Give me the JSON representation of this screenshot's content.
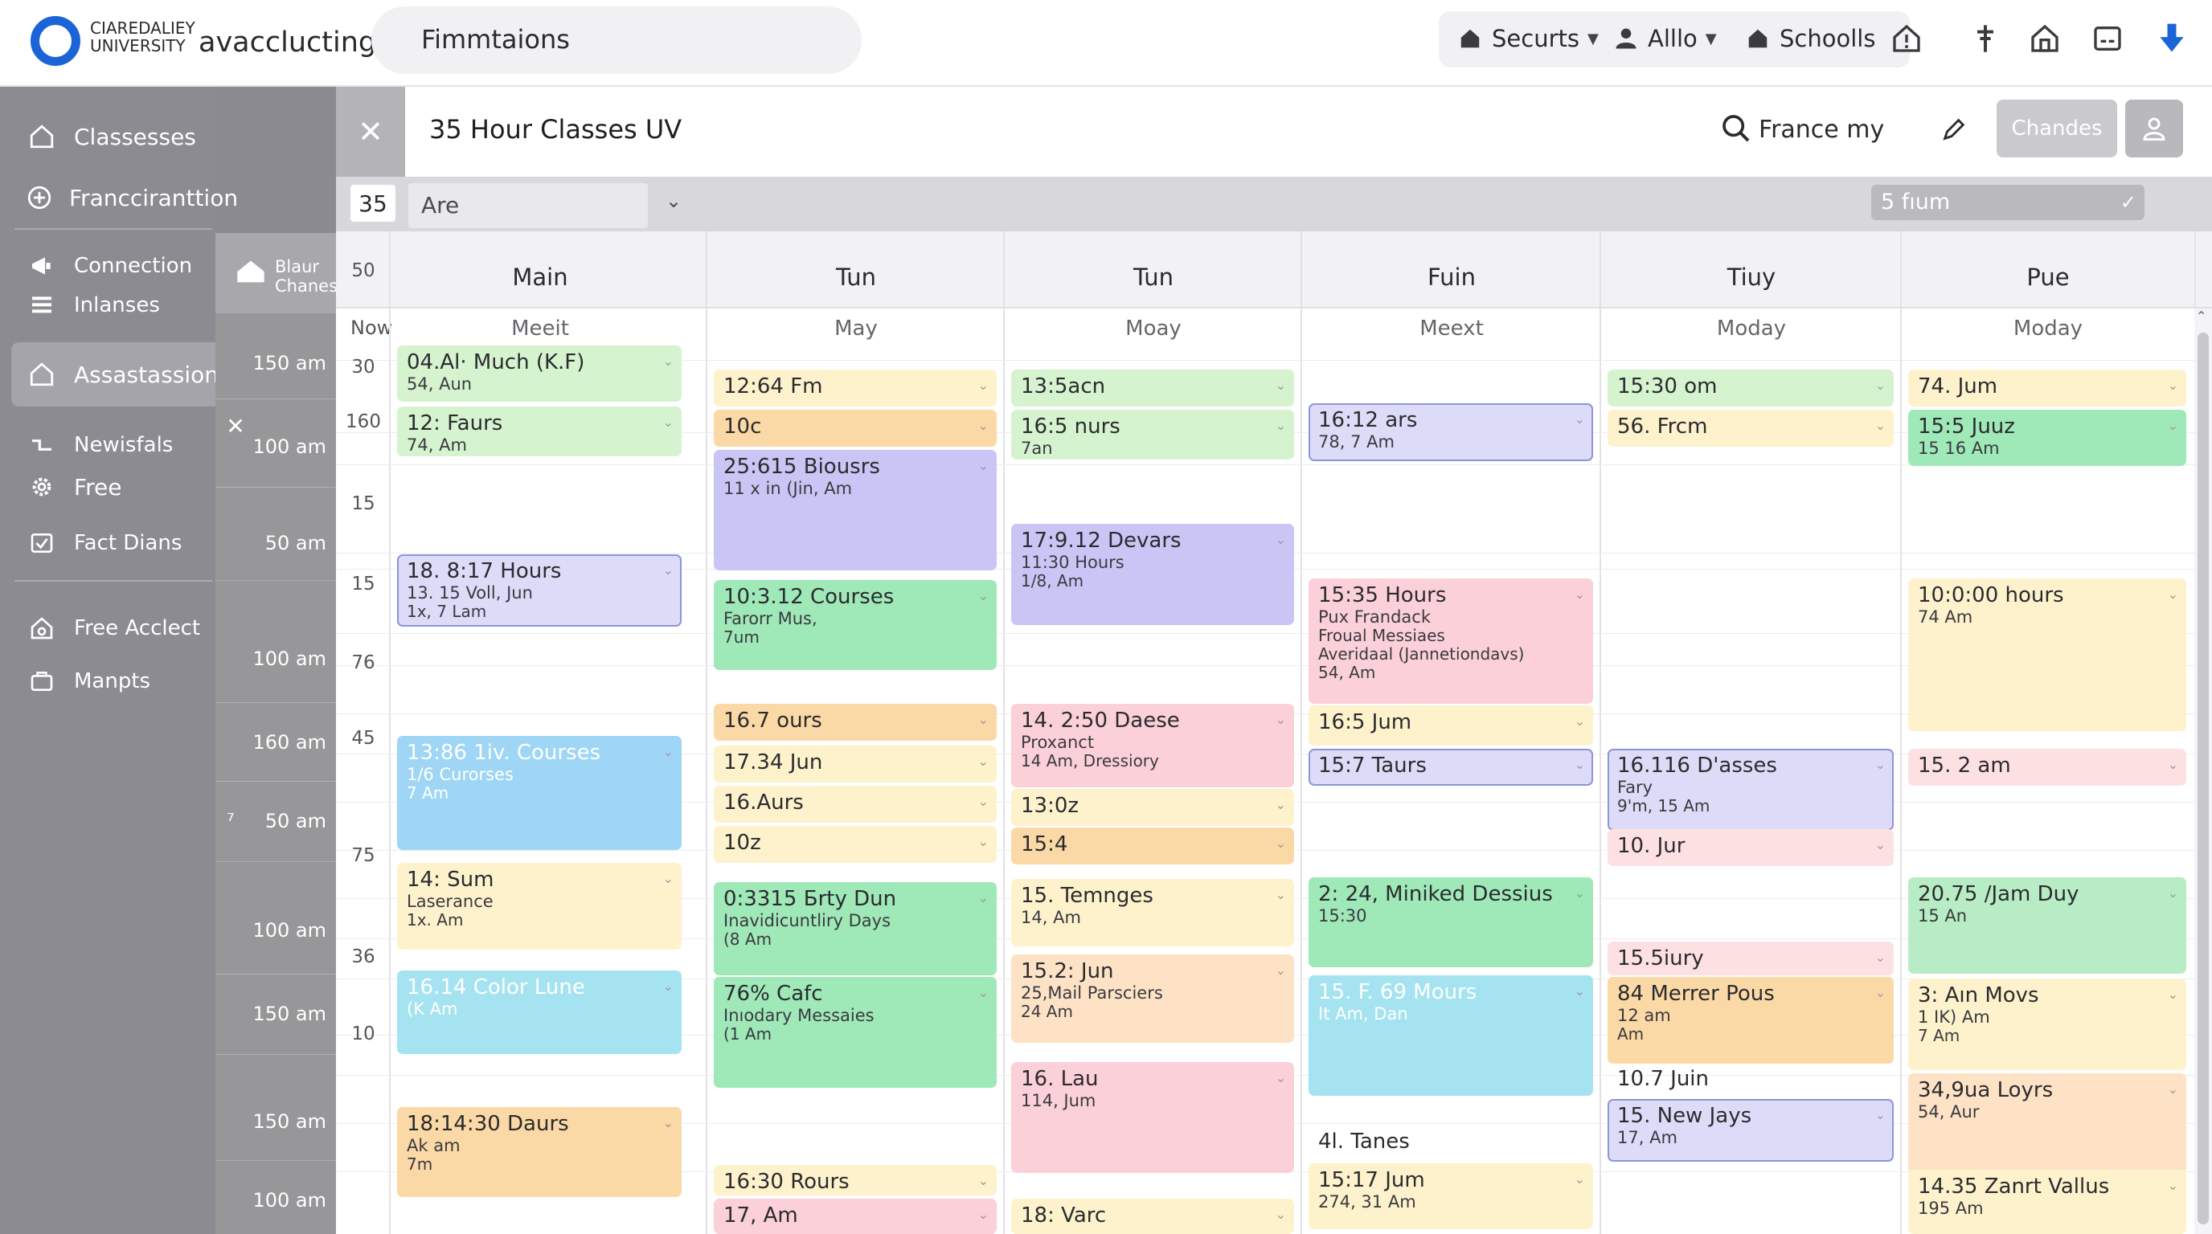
{
  "app": {
    "logo_small": "CIAREDALIEY UNIVERSITY",
    "logo_main": "avacclucting",
    "search_text": "Fimmtaions"
  },
  "topnav": {
    "items": [
      {
        "label": "Securts",
        "icon": "home-icon"
      },
      {
        "label": "Alllo",
        "icon": "user-icon"
      },
      {
        "label": "Schoolls",
        "icon": "home-icon"
      }
    ],
    "icons": [
      "alert-house-icon",
      "f-icon",
      "building-icon",
      "panel-icon",
      "download-icon"
    ]
  },
  "sidebar": {
    "items": [
      {
        "label": "Classesses",
        "icon": "home-icon"
      },
      {
        "label": "Francciranttion",
        "icon": "plus-circle-icon"
      },
      {
        "label": "Connection",
        "icon": "megaphone-icon"
      },
      {
        "label": "Inlanses",
        "icon": "list-icon"
      },
      {
        "label": "Assastassions",
        "icon": "home-icon",
        "active": true
      },
      {
        "label": "Newisfals",
        "icon": "route-icon"
      },
      {
        "label": "Free",
        "icon": "gear-icon"
      },
      {
        "label": "Fact Dians",
        "icon": "check-box-icon"
      },
      {
        "label": "Free Acclect",
        "icon": "home-gear-icon"
      },
      {
        "label": "Manpts",
        "icon": "briefcase-icon"
      }
    ],
    "sub_header": "Blaur Chanes",
    "times": [
      "150 am",
      "100 am",
      "50 am",
      "100 am",
      "160 am",
      "50 am",
      "100 am",
      "150 am",
      "150 am",
      "100 am"
    ]
  },
  "panel": {
    "title": "35 Hour Classes UV",
    "search_text": "France my",
    "changes_button": "Chandes",
    "filter_number": "35",
    "filter_select": "Are",
    "filter_right": "5 fıum"
  },
  "calendar": {
    "gutter_now": "Now",
    "row_numbers": [
      "10",
      "50",
      "30",
      "160",
      "15",
      "15",
      "76",
      "45",
      "75",
      "36",
      "10"
    ],
    "columns": [
      {
        "day": "Main",
        "sub": "Meeit"
      },
      {
        "day": "Tun",
        "sub": "May"
      },
      {
        "day": "Tun",
        "sub": "Moay"
      },
      {
        "day": "Fuin",
        "sub": "Meext"
      },
      {
        "day": "Tiuy",
        "sub": "Moday"
      },
      {
        "day": "Pue",
        "sub": "Moday"
      }
    ],
    "events": [
      {
        "col": 0,
        "lines": [
          "04.Al· Much (K.F)",
          "54, Aun"
        ],
        "color": "lgreen"
      },
      {
        "col": 0,
        "lines": [
          "12: Faurs",
          "74, Am"
        ],
        "color": "lgreen"
      },
      {
        "col": 0,
        "lines": [
          "18. 8:17 Hours",
          "13. 15 Voll, Jun",
          "1x, 7 Lam"
        ],
        "color": "lilac"
      },
      {
        "col": 0,
        "lines": [
          "13:86 1iv. Courses",
          "1/6 Curorses",
          "7 Am"
        ],
        "color": "blue"
      },
      {
        "col": 0,
        "lines": [
          "14: Sum",
          "Laserance",
          "1x. Am"
        ],
        "color": "yellow"
      },
      {
        "col": 0,
        "lines": [
          "16.14 Color Lune",
          "(K Am"
        ],
        "color": "cyan"
      },
      {
        "col": 0,
        "lines": [
          "18:14:30 Daurs",
          "Ak am",
          "7m"
        ],
        "color": "orange"
      },
      {
        "col": 1,
        "lines": [
          "12:64 Fm"
        ],
        "color": "yellow"
      },
      {
        "col": 1,
        "lines": [
          "10c"
        ],
        "color": "orange"
      },
      {
        "col": 1,
        "lines": [
          "25:615 Biousrs",
          "11 x in (Jin, Am"
        ],
        "color": "purple"
      },
      {
        "col": 1,
        "lines": [
          "10:3.12 Courses",
          "Farorr Mus,",
          "7um"
        ],
        "color": "mint"
      },
      {
        "col": 1,
        "lines": [
          "16.7 ours"
        ],
        "color": "orange"
      },
      {
        "col": 1,
        "lines": [
          "17.34 Jun"
        ],
        "color": "yellow"
      },
      {
        "col": 1,
        "lines": [
          "16.Aurs"
        ],
        "color": "yellow"
      },
      {
        "col": 1,
        "lines": [
          "10z"
        ],
        "color": "yellow"
      },
      {
        "col": 1,
        "lines": [
          "0:3315 Бrty Dun",
          "Inavidicuntliry Days",
          "(8 Am"
        ],
        "color": "mint"
      },
      {
        "col": 1,
        "lines": [
          "76% Cafc",
          "Inıodary Messaies",
          "(1 Am"
        ],
        "color": "mint"
      },
      {
        "col": 1,
        "lines": [
          "16:30 Rours"
        ],
        "color": "yellow"
      },
      {
        "col": 1,
        "lines": [
          "17, Am"
        ],
        "color": "pink"
      },
      {
        "col": 2,
        "lines": [
          "13:5acn"
        ],
        "color": "lgreen"
      },
      {
        "col": 2,
        "lines": [
          "16:5 nurs",
          "7an"
        ],
        "color": "lgreen"
      },
      {
        "col": 2,
        "lines": [
          "17:9.12 Devars",
          "11:30 Hours",
          "1/8, Am"
        ],
        "color": "purple"
      },
      {
        "col": 2,
        "lines": [
          "14. 2:50 Daese",
          "Proxanct",
          "14 Am, Dressiory"
        ],
        "color": "pink"
      },
      {
        "col": 2,
        "lines": [
          "13:0z"
        ],
        "color": "yellow"
      },
      {
        "col": 2,
        "lines": [
          "15:4"
        ],
        "color": "orange"
      },
      {
        "col": 2,
        "lines": [
          "15. Temnges",
          "14, Am"
        ],
        "color": "yellow"
      },
      {
        "col": 2,
        "lines": [
          "15.2: Jun",
          "25,Mail Parsciers",
          "24 Am"
        ],
        "color": "peach"
      },
      {
        "col": 2,
        "lines": [
          "16. Lau",
          "114, Jum"
        ],
        "color": "pink"
      },
      {
        "col": 2,
        "lines": [
          "18: Varc"
        ],
        "color": "yellow"
      },
      {
        "col": 3,
        "lines": [
          "16:12 ars",
          "78, 7 Am"
        ],
        "color": "lilac"
      },
      {
        "col": 3,
        "lines": [
          "15:35 Hours",
          "Pux Frandack",
          "Froual Messiaes",
          "Averidaal (Jannetiondavs)",
          "54, Am"
        ],
        "color": "pink"
      },
      {
        "col": 3,
        "lines": [
          "16:5 Jum"
        ],
        "color": "yellow"
      },
      {
        "col": 3,
        "lines": [
          "15:7 Taurs"
        ],
        "color": "lilac"
      },
      {
        "col": 3,
        "lines": [
          "2: 24, Miniked Dessius",
          "15:30"
        ],
        "color": "mint"
      },
      {
        "col": 3,
        "lines": [
          "15. F. 69 Mours",
          "It Am, Dan"
        ],
        "color": "cyan"
      },
      {
        "col": 3,
        "lines": [
          "4l. Tanes"
        ],
        "color": "none"
      },
      {
        "col": 3,
        "lines": [
          "15:17 Jum",
          "274, 31 Am"
        ],
        "color": "yellow"
      },
      {
        "col": 4,
        "lines": [
          "15:30 om"
        ],
        "color": "lgreen"
      },
      {
        "col": 4,
        "lines": [
          "56. Frcm"
        ],
        "color": "yellow"
      },
      {
        "col": 4,
        "lines": [
          "16.116 D'asses",
          "Fary",
          "9'm, 15 Am"
        ],
        "color": "lilac"
      },
      {
        "col": 4,
        "lines": [
          "10. Jur"
        ],
        "color": "lpink"
      },
      {
        "col": 4,
        "lines": [
          "15.5iury"
        ],
        "color": "lpink"
      },
      {
        "col": 4,
        "lines": [
          "84 Merrer Pous",
          "12 am",
          "Am"
        ],
        "color": "orange"
      },
      {
        "col": 4,
        "lines": [
          "10.7 Juin"
        ],
        "color": "none"
      },
      {
        "col": 4,
        "lines": [
          "15. New Jays",
          "17, Am"
        ],
        "color": "lilac"
      },
      {
        "col": 5,
        "lines": [
          "74. Jum"
        ],
        "color": "yellow"
      },
      {
        "col": 5,
        "lines": [
          "15:5 Juuz",
          "15 16 Am"
        ],
        "color": "mint"
      },
      {
        "col": 5,
        "lines": [
          "10:0:00 hours",
          "74 Am"
        ],
        "color": "yellow"
      },
      {
        "col": 5,
        "lines": [
          "15. 2 am"
        ],
        "color": "lpink"
      },
      {
        "col": 5,
        "lines": [
          "20.75 /Jam Duy",
          "15 An"
        ],
        "color": "green2"
      },
      {
        "col": 5,
        "lines": [
          "3: Aın Movs",
          "1 IK) Am",
          "7 Am"
        ],
        "color": "yellow"
      },
      {
        "col": 5,
        "lines": [
          "34,9ua Loyrs",
          "54, Aur"
        ],
        "color": "peach"
      },
      {
        "col": 5,
        "lines": [
          "14.35 Zanrt Vallus",
          "195 Am"
        ],
        "color": "yellow"
      }
    ]
  }
}
